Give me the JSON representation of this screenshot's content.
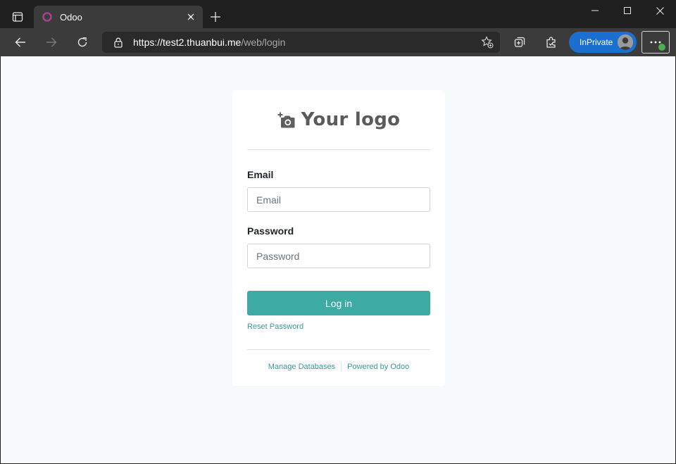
{
  "browser": {
    "tab": {
      "title": "Odoo",
      "favicon_color": "#a24689"
    },
    "address": {
      "host": "https://test2.thuanbui.me",
      "path": "/web/login"
    },
    "inprivate_label": "InPrivate",
    "icons": {
      "tab_actions": "tab-actions-icon",
      "close": "close-icon",
      "new_tab": "plus-icon",
      "back": "arrow-left-icon",
      "forward": "arrow-right-icon",
      "refresh": "refresh-icon",
      "lock": "lock-icon",
      "favorites": "star-plus-icon",
      "collections": "collections-icon",
      "extensions": "extensions-icon",
      "more": "more-icon"
    },
    "accent": "#1a6fd1"
  },
  "login": {
    "logo_text": "Your logo",
    "email_label": "Email",
    "email_placeholder": "Email",
    "email_value": "",
    "password_label": "Password",
    "password_placeholder": "Password",
    "password_value": "",
    "login_button": "Log in",
    "reset_password": "Reset Password",
    "footer": {
      "manage_databases": "Manage Databases",
      "powered_by": "Powered by Odoo"
    },
    "brand_color": "#3daaa4"
  }
}
